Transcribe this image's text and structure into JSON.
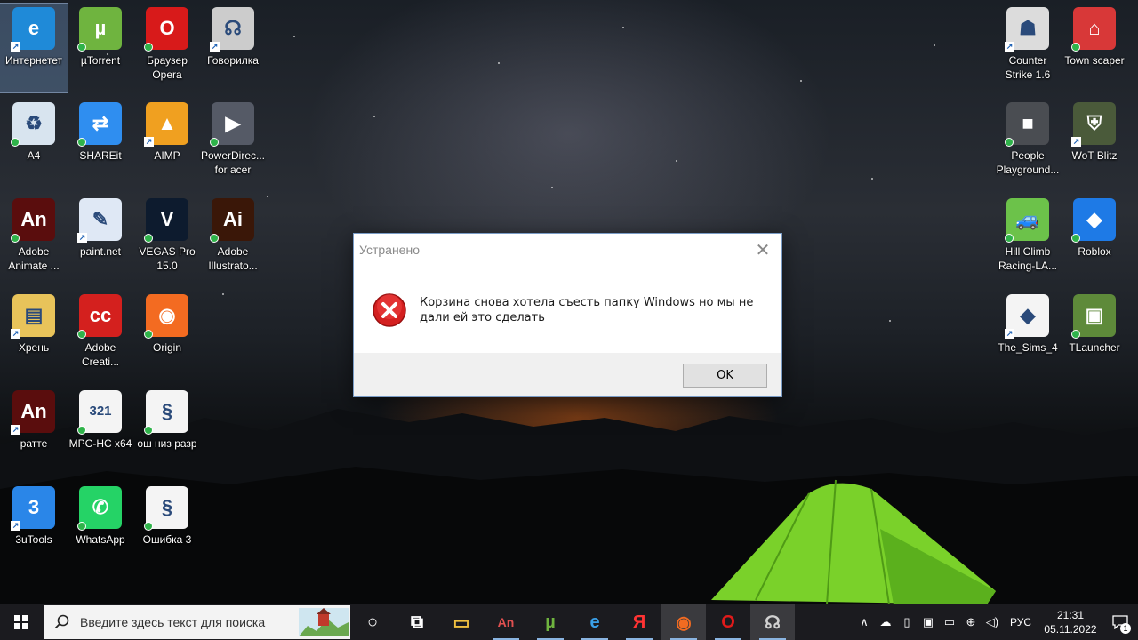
{
  "desktop_icons": [
    {
      "label": "Интернетет",
      "icon": "edge-icon",
      "color": "#1f8ad8",
      "glyph": "e"
    },
    {
      "label": "µTorrent",
      "icon": "utorrent-icon",
      "color": "#6fb43f",
      "glyph": "µ"
    },
    {
      "label": "Браузер Opera",
      "icon": "opera-icon",
      "color": "#d81a1a",
      "glyph": "O"
    },
    {
      "label": "Говорилка",
      "icon": "govorilka-icon",
      "color": "#cccccc",
      "glyph": "☊"
    },
    {
      "label": "A4",
      "icon": "recycle-bin-icon",
      "color": "#d8e4ef",
      "glyph": "♻"
    },
    {
      "label": "SHAREit",
      "icon": "shareit-icon",
      "color": "#2f8ef0",
      "glyph": "⇄"
    },
    {
      "label": "AIMP",
      "icon": "aimp-icon",
      "color": "#f0a020",
      "glyph": "▲"
    },
    {
      "label": "PowerDirec... for acer",
      "icon": "powerdirector-icon",
      "color": "#555a66",
      "glyph": "▶"
    },
    {
      "label": "Adobe Animate ...",
      "icon": "adobe-animate-icon",
      "color": "#5a0d0d",
      "glyph": "An"
    },
    {
      "label": "paint.net",
      "icon": "paintnet-icon",
      "color": "#dfe8f5",
      "glyph": "✎"
    },
    {
      "label": "VEGAS Pro 15.0",
      "icon": "vegas-icon",
      "color": "#0d1b2e",
      "glyph": "V"
    },
    {
      "label": "Adobe Illustrato...",
      "icon": "adobe-illustrator-icon",
      "color": "#3a1708",
      "glyph": "Ai"
    },
    {
      "label": "Хрень",
      "icon": "folder-icon",
      "color": "#e8c35a",
      "glyph": "▤"
    },
    {
      "label": "Adobe Creati...",
      "icon": "adobe-cc-icon",
      "color": "#d4201e",
      "glyph": "cc"
    },
    {
      "label": "Origin",
      "icon": "origin-icon",
      "color": "#f36b21",
      "glyph": "◉"
    },
    {
      "label": "ратте",
      "icon": "animate-file-icon",
      "color": "#5a0d0d",
      "glyph": "An"
    },
    {
      "label": "MPC-HC x64",
      "icon": "mpc-hc-icon",
      "color": "#f4f4f4",
      "glyph": "321"
    },
    {
      "label": "ош низ разр",
      "icon": "script-file-icon",
      "color": "#f4f4f4",
      "glyph": "§"
    },
    {
      "label": "3uTools",
      "icon": "3utools-icon",
      "color": "#2a86e8",
      "glyph": "3"
    },
    {
      "label": "WhatsApp",
      "icon": "whatsapp-icon",
      "color": "#25d366",
      "glyph": "✆"
    },
    {
      "label": "Ошибка 3",
      "icon": "script-file-icon",
      "color": "#f4f4f4",
      "glyph": "§"
    },
    {
      "label": "Counter Strike 1.6",
      "icon": "counter-strike-icon",
      "color": "#dcdcdc",
      "glyph": "☗"
    },
    {
      "label": "Town scaper",
      "icon": "townscaper-icon",
      "color": "#d83838",
      "glyph": "⌂"
    },
    {
      "label": "People Playground...",
      "icon": "people-playground-icon",
      "color": "#4a4d52",
      "glyph": "■"
    },
    {
      "label": "WoT Blitz",
      "icon": "wot-blitz-icon",
      "color": "#4a5a3a",
      "glyph": "⛨"
    },
    {
      "label": "Hill Climb Racing-LA...",
      "icon": "hill-climb-icon",
      "color": "#6cc24a",
      "glyph": "🚙"
    },
    {
      "label": "Roblox",
      "icon": "roblox-icon",
      "color": "#1e7ae6",
      "glyph": "◆"
    },
    {
      "label": "The_Sims_4",
      "icon": "sims-icon",
      "color": "#f4f4f4",
      "glyph": "◆"
    },
    {
      "label": "TLauncher",
      "icon": "tlauncher-icon",
      "color": "#5e8a3a",
      "glyph": "▣"
    }
  ],
  "dialog": {
    "title": "Устранено",
    "message": "Корзина снова хотела съесть папку Windows но мы не дали ей это сделать",
    "ok_label": "OK",
    "close_glyph": "✕"
  },
  "taskbar": {
    "search_placeholder": "Введите здесь текст для поиска",
    "apps": [
      {
        "icon": "cortana-icon",
        "glyph": "○"
      },
      {
        "icon": "task-view-icon",
        "glyph": "⧉"
      },
      {
        "icon": "file-explorer-icon",
        "glyph": "▭"
      },
      {
        "icon": "adobe-animate-icon",
        "glyph": "An"
      },
      {
        "icon": "utorrent-icon",
        "glyph": "µ"
      },
      {
        "icon": "edge-icon",
        "glyph": "e"
      },
      {
        "icon": "yandex-icon",
        "glyph": "Я"
      },
      {
        "icon": "aimp-icon",
        "glyph": "◉"
      },
      {
        "icon": "opera-icon",
        "glyph": "O"
      },
      {
        "icon": "govorilka-icon",
        "glyph": "☊"
      }
    ],
    "tray": {
      "language": "РУС",
      "time": "21:31",
      "date": "05.11.2022",
      "notification_count": "1"
    }
  }
}
